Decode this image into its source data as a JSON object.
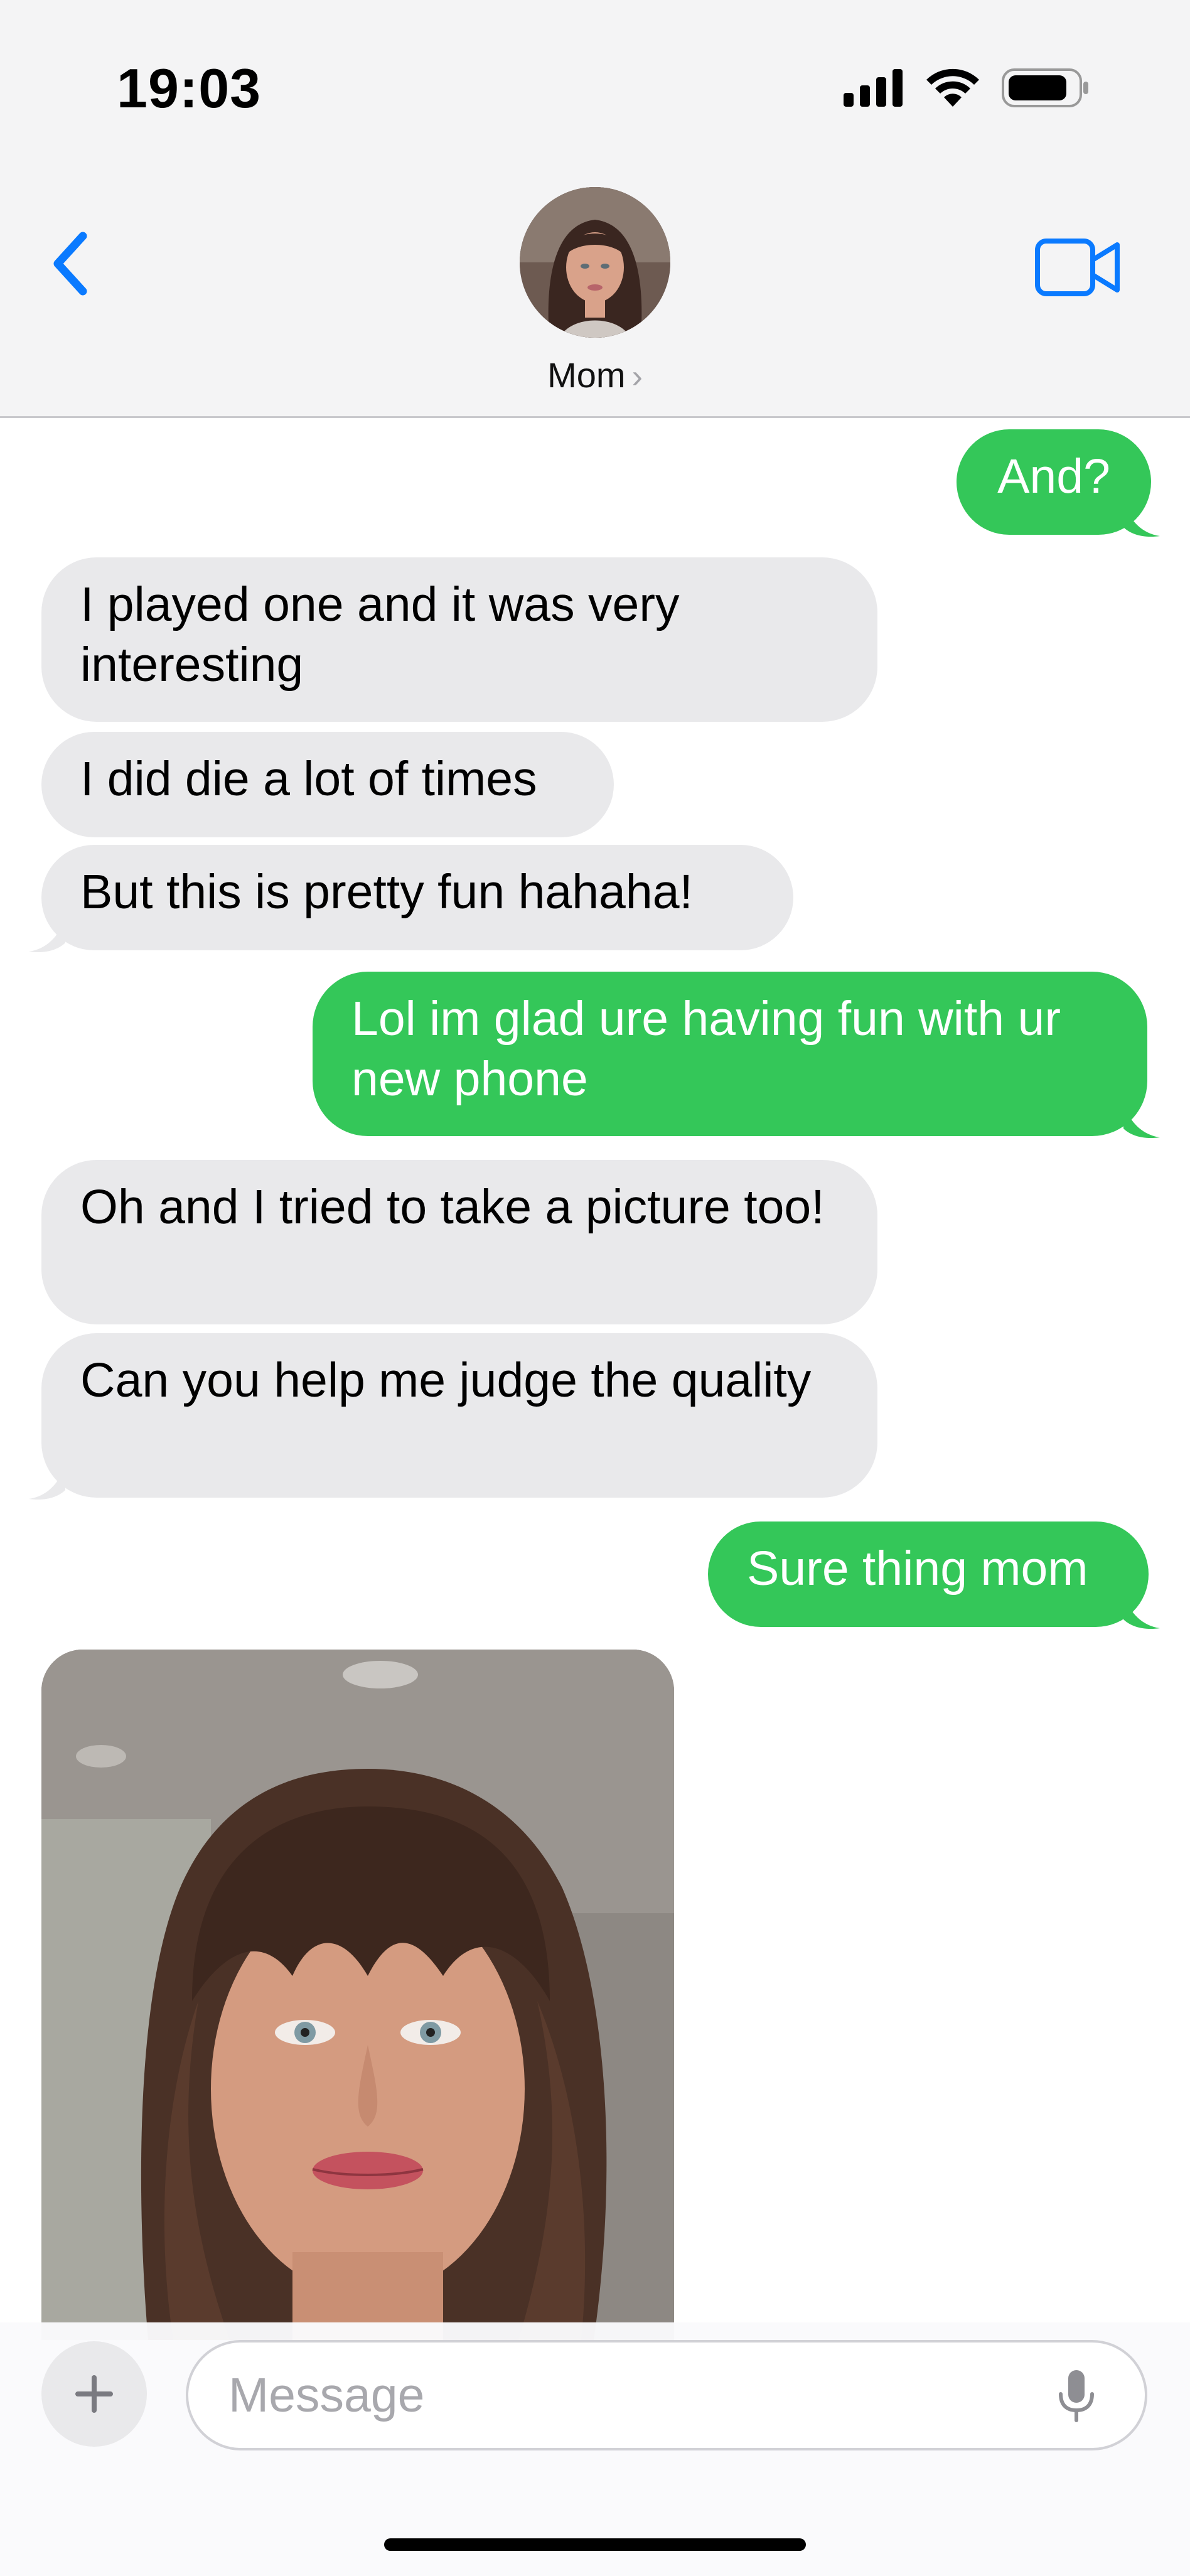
{
  "status_bar": {
    "time": "19:03"
  },
  "header": {
    "contact_name": "Mom",
    "chevron": "›",
    "icons": {
      "back": "chevron-left-icon",
      "video": "video-camera-icon"
    },
    "accent_color": "#0a7aff"
  },
  "messages": [
    {
      "direction": "out",
      "text": "And?"
    },
    {
      "direction": "in",
      "text": "I played one and it was very interesting"
    },
    {
      "direction": "in",
      "text": "I did die a lot of times"
    },
    {
      "direction": "in",
      "text": "But this is pretty fun hahaha!"
    },
    {
      "direction": "out",
      "text": "Lol im glad ure having fun with ur new phone"
    },
    {
      "direction": "in",
      "text": "Oh and I tried to take a picture too!"
    },
    {
      "direction": "in",
      "text": "Can you help me judge the quality"
    },
    {
      "direction": "out",
      "text": "Sure thing mom"
    },
    {
      "direction": "in",
      "type": "photo"
    }
  ],
  "colors": {
    "outgoing_bubble": "#34c759",
    "incoming_bubble": "#e9e9eb",
    "header_background": "#f4f4f5"
  },
  "composer": {
    "placeholder": "Message",
    "icons": {
      "plus": "plus-icon",
      "mic": "microphone-icon"
    }
  }
}
